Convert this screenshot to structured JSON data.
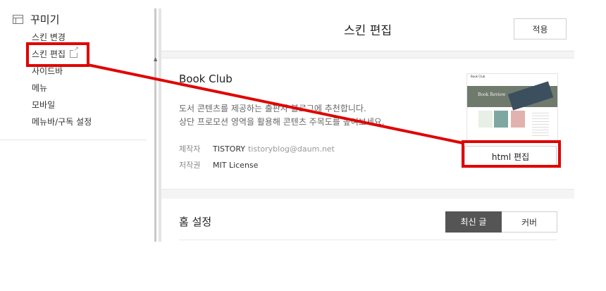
{
  "sidebar": {
    "title": "꾸미기",
    "icon": "layout-icon",
    "items": [
      {
        "label": "스킨 변경"
      },
      {
        "label": "스킨 편집",
        "external": true
      },
      {
        "label": "사이드바"
      },
      {
        "label": "메뉴"
      },
      {
        "label": "모바일"
      },
      {
        "label": "메뉴바/구독 설정"
      }
    ]
  },
  "panel": {
    "title": "스킨 편집",
    "apply_label": "적용"
  },
  "skin": {
    "name": "Book Club",
    "description_lines": [
      "도서 콘텐츠를 제공하는 출판사 블로그에 추천합니다.",
      "상단 프로모션 영역을 활용해 콘텐츠 주목도를 높여보세요."
    ],
    "author_label": "제작자",
    "author": "TISTORY",
    "author_email": "tistoryblog@daum.net",
    "license_label": "저작권",
    "license": "MIT License",
    "html_edit_label": "html 편집",
    "thumbnail": {
      "header": "Book Club",
      "hero_text": "Book Review"
    }
  },
  "home": {
    "title": "홈 설정",
    "tabs": [
      {
        "label": "최신 글",
        "selected": true
      },
      {
        "label": "커버",
        "selected": false
      }
    ]
  },
  "colors": {
    "annotation": "#e00000",
    "selected_tab": "#555555"
  }
}
